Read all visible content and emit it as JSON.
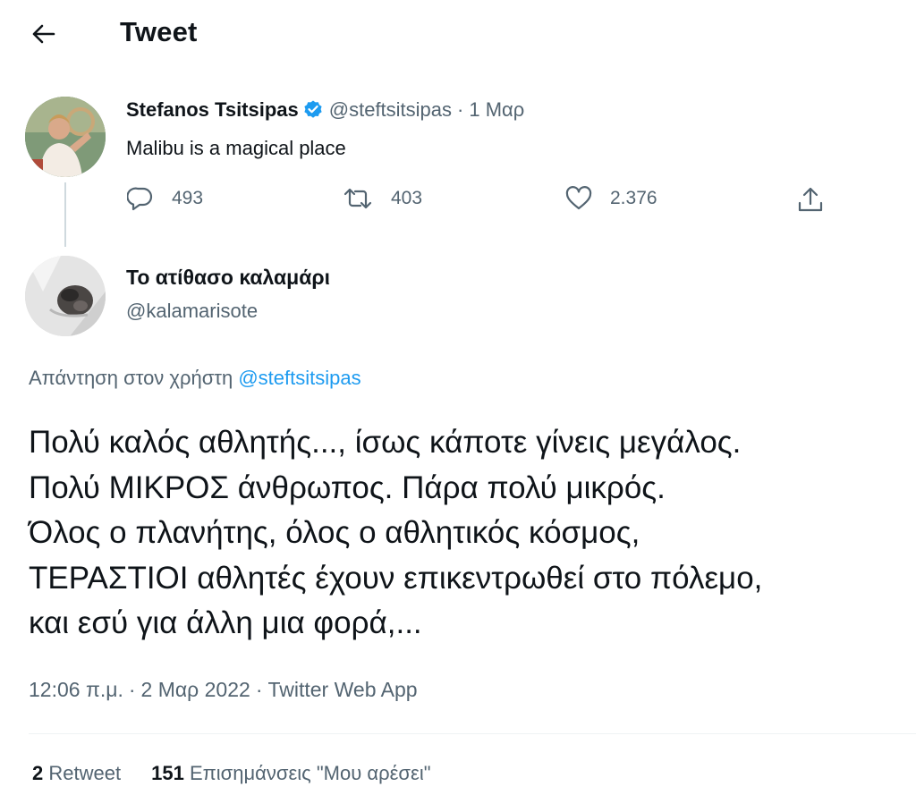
{
  "header": {
    "title": "Tweet",
    "back_icon": "arrow-left-icon"
  },
  "parent_tweet": {
    "name": "Stefanos Tsitsipas",
    "verified": true,
    "handle": "@steftsitsipas",
    "separator": "·",
    "date": "1 Μαρ",
    "text": "Malibu is a magical place",
    "actions": {
      "replies": "493",
      "retweets": "403",
      "likes": "2.376"
    }
  },
  "reply_tweet": {
    "name": "Το ατίθασο καλαμάρι",
    "handle": "@kalamarisote",
    "reply_prefix": "Απάντηση στον χρήστη",
    "reply_mention": "@steftsitsipas",
    "lines": [
      "Πολύ καλός αθλητής..., ίσως κάποτε γίνεις μεγάλος.",
      "Πολύ ΜΙΚΡΟΣ άνθρωπος. Πάρα πολύ μικρός.",
      "Όλος ο πλανήτης, όλος ο αθλητικός κόσμος,",
      "ΤΕΡΑΣΤΙΟΙ αθλητές έχουν επικεντρωθεί στο πόλεμο,",
      "και εσύ για άλλη μια φορά,..."
    ],
    "time": "12:06 π.μ.",
    "date": "2 Μαρ 2022",
    "source": "Twitter Web App",
    "separator": "·",
    "retweets_count": "2",
    "retweets_label": "Retweet",
    "likes_count": "151",
    "likes_label": "Επισημάνσεις \"Μου αρέσει\""
  },
  "colors": {
    "text": "#0f1419",
    "secondary": "#536471",
    "accent": "#1d9bf0",
    "divider": "#eff3f4"
  }
}
